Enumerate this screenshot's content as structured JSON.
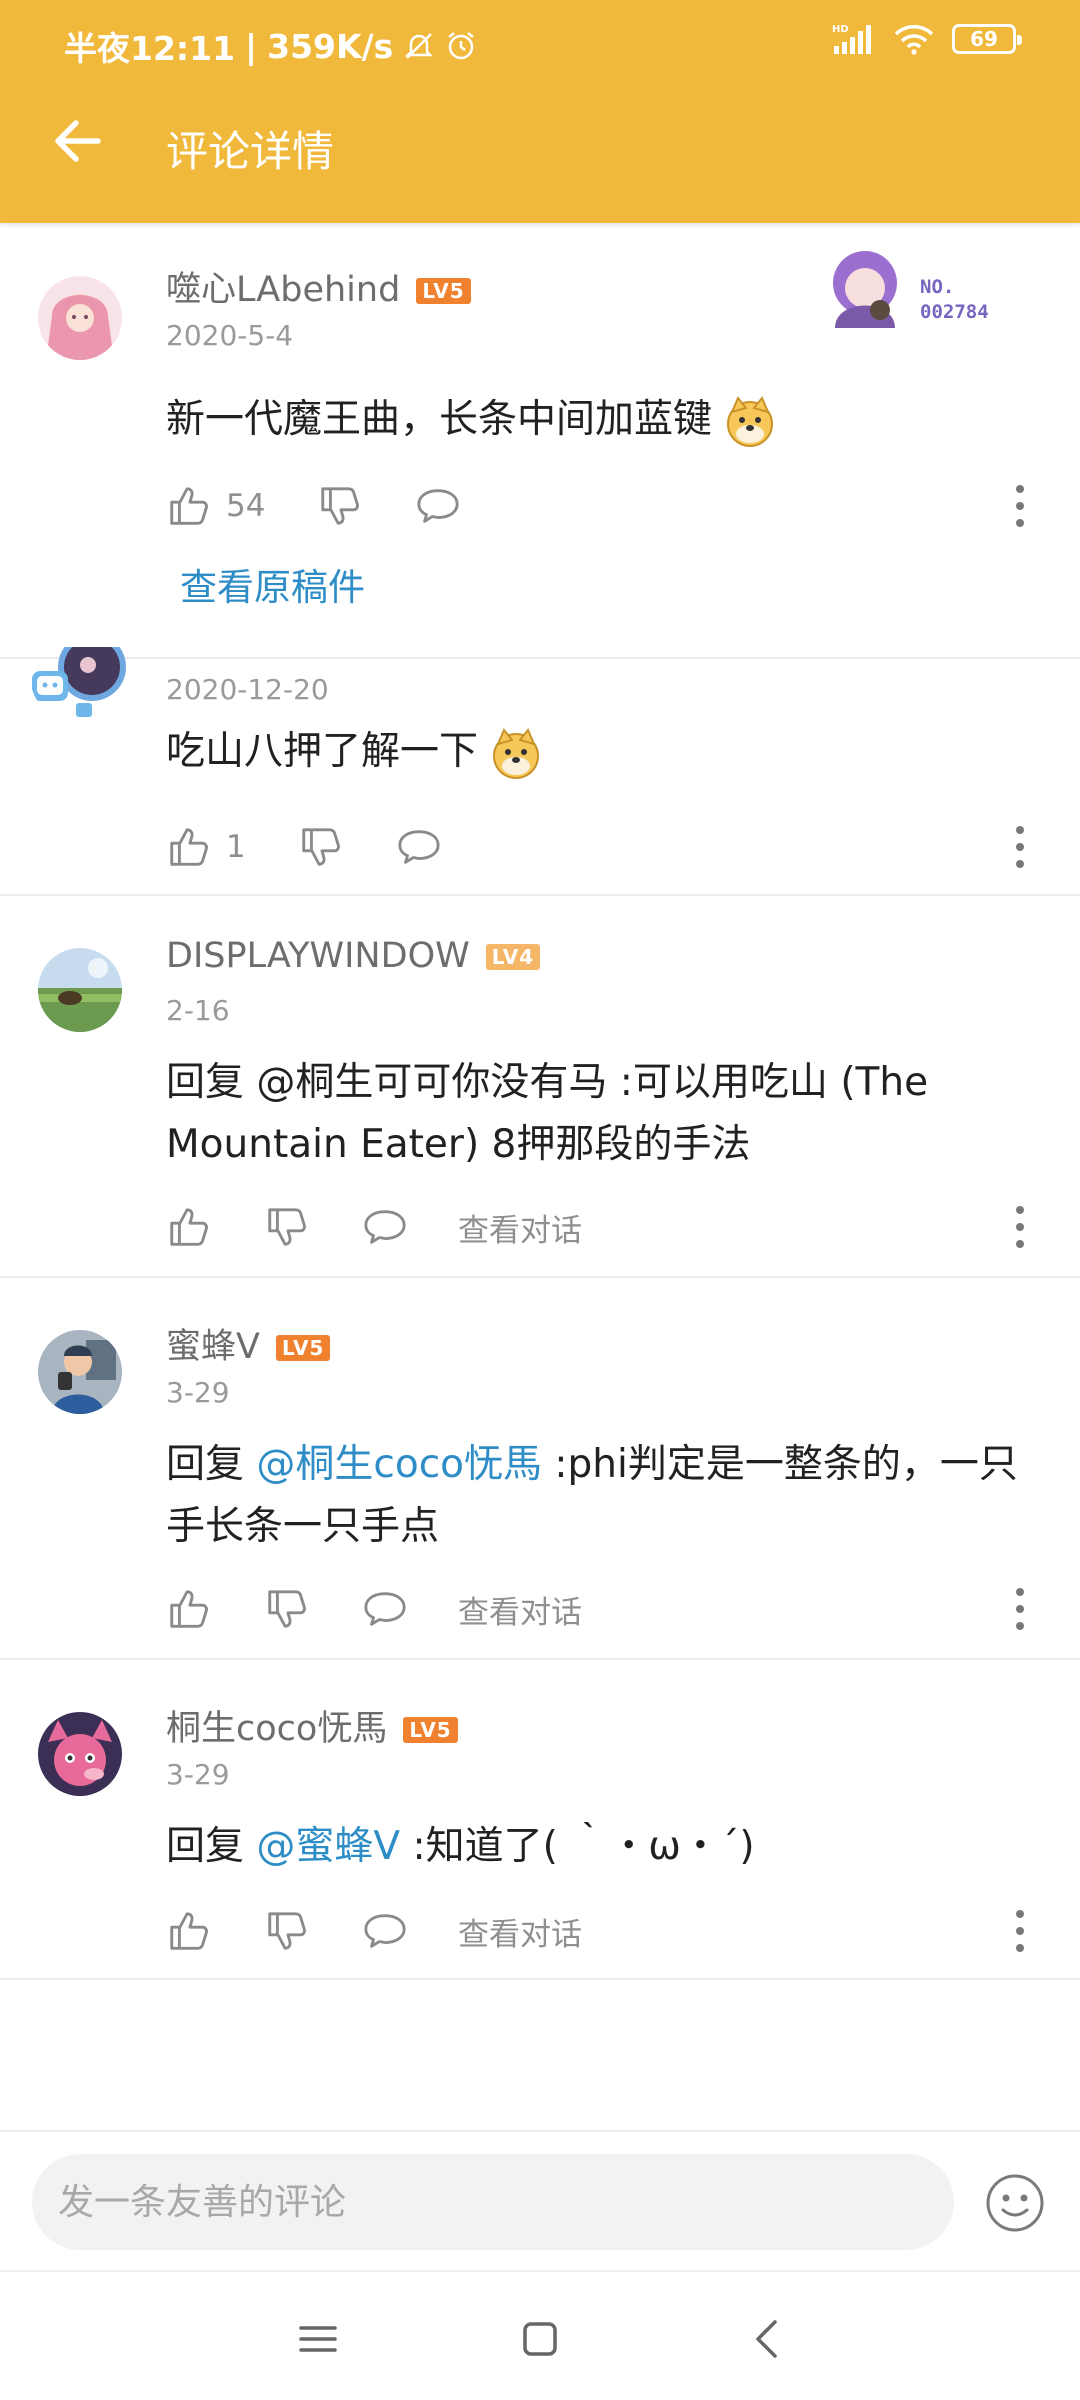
{
  "status_bar": {
    "time": "半夜12:11",
    "speed": "359K/s",
    "network": "HD",
    "battery": "69"
  },
  "header": {
    "title": "评论详情"
  },
  "comments": [
    {
      "username": "噬心LAbehind",
      "level": "LV5",
      "date": "2020-5-4",
      "text": "新一代魔王曲，长条中间加蓝键",
      "likes": "54",
      "view_original": "查看原稿件",
      "badge_no_label": "NO.",
      "badge_no": "002784"
    },
    {
      "date": "2020-12-20",
      "text": "吃山八押了解一下",
      "likes": "1"
    },
    {
      "username": "DISPLAYWINDOW",
      "level": "LV4",
      "date": "2-16",
      "text": "回复 @桐生可可你没有马 :可以用吃山 (The Mountain Eater) 8押那段的手法",
      "view_dialog": "查看对话"
    },
    {
      "username": "蜜蜂V",
      "level": "LV5",
      "date": "3-29",
      "reply_prefix": "回复 ",
      "mention": "@桐生coco怃馬",
      "text": " :phi判定是一整条的，一只手长条一只手点",
      "view_dialog": "查看对话"
    },
    {
      "username": "桐生coco怃馬",
      "level": "LV5",
      "date": "3-29",
      "reply_prefix": "回复 ",
      "mention": "@蜜蜂V",
      "text": " :知道了( ｀・ω・´)",
      "view_dialog": "查看对话"
    }
  ],
  "input": {
    "placeholder": "发一条友善的评论"
  },
  "colors": {
    "header": "#f1b93b",
    "link": "#2e8dc6",
    "level_lv5": "#f0812e",
    "level_lv4": "#f6b668"
  }
}
